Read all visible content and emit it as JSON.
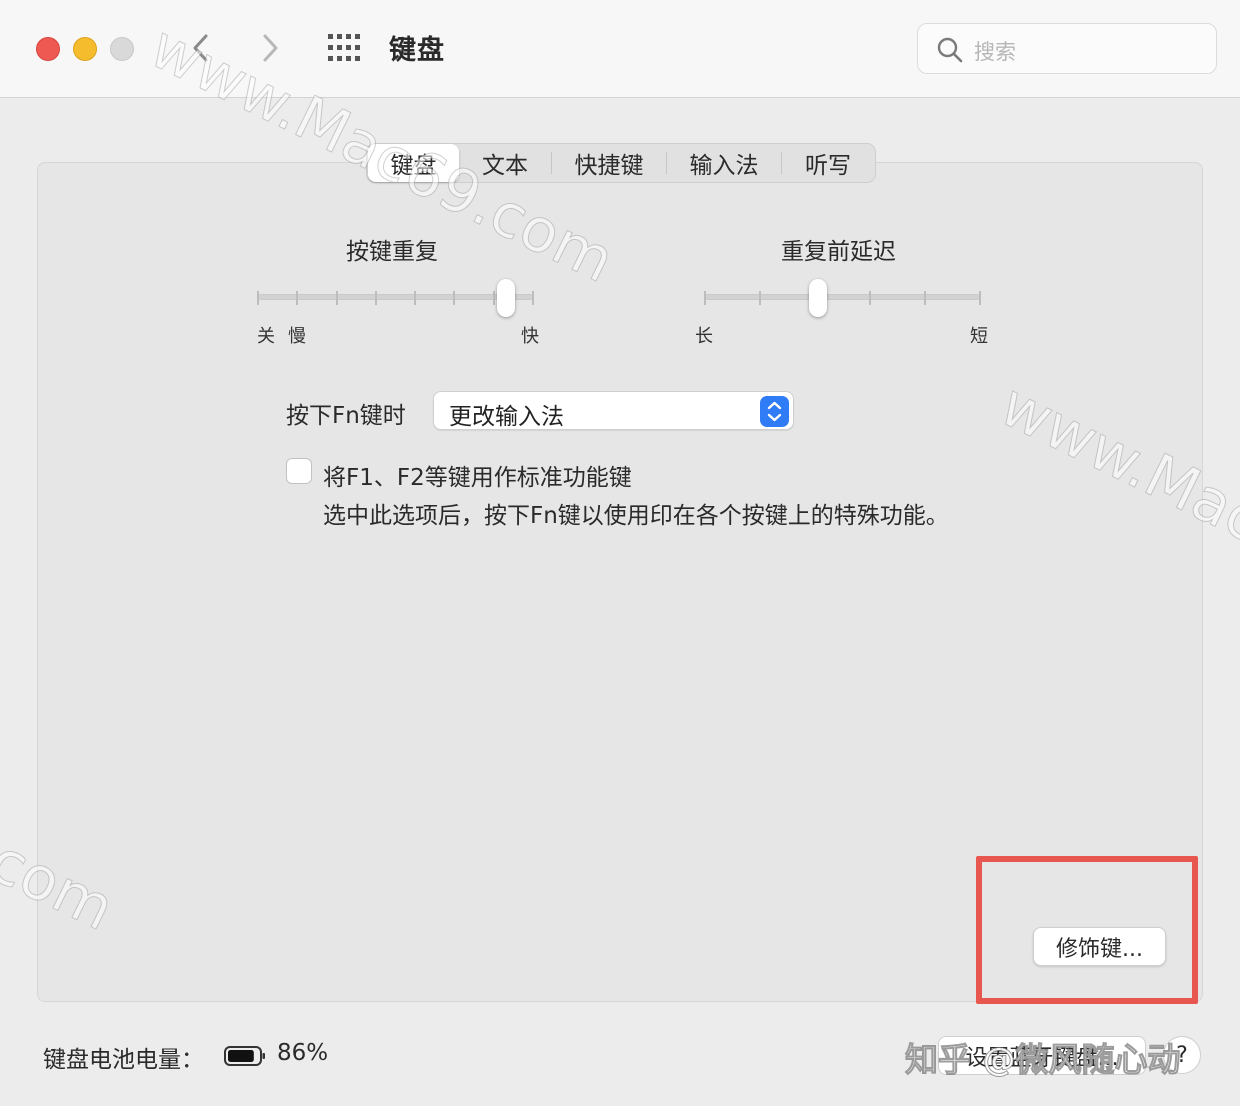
{
  "window": {
    "title": "键盘",
    "search_placeholder": "搜索"
  },
  "tabs": [
    {
      "label": "键盘",
      "active": true
    },
    {
      "label": "文本",
      "active": false
    },
    {
      "label": "快捷键",
      "active": false
    },
    {
      "label": "输入法",
      "active": false
    },
    {
      "label": "听写",
      "active": false
    }
  ],
  "key_repeat": {
    "title": "按键重复",
    "label_off": "关",
    "label_slow": "慢",
    "label_fast": "快",
    "stops": 8,
    "selected_stop": 7
  },
  "repeat_delay": {
    "title": "重复前延迟",
    "label_long": "长",
    "label_short": "短",
    "stops": 6,
    "selected_stop": 3
  },
  "fn_key": {
    "label": "按下Fn键时",
    "value": "更改输入法"
  },
  "function_keys": {
    "checked": false,
    "label": "将F1、F2等键用作标准功能键",
    "description": "选中此选项后，按下Fn键以使用印在各个按键上的特殊功能。"
  },
  "modifier_button": "修饰键...",
  "battery": {
    "label": "键盘电池电量：",
    "percent": "86%",
    "level": 0.86
  },
  "bluetooth_button": "设置蓝牙键盘...",
  "help_button": "?",
  "watermarks": {
    "site": "www.Mac69.com",
    "corner": "知乎 @微风随心动"
  },
  "colors": {
    "close": "#ee5a52",
    "minimize": "#f5bd2e",
    "accent": "#2f7cf6",
    "highlight": "#e8574f"
  }
}
